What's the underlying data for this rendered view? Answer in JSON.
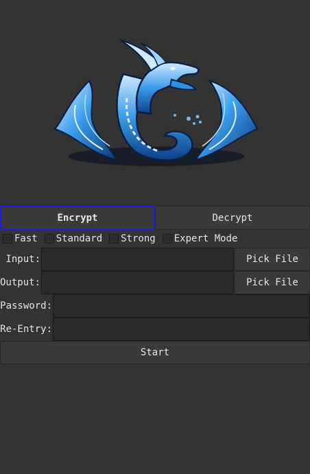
{
  "tabs": {
    "encrypt_label": "Encrypt",
    "decrypt_label": "Decrypt"
  },
  "modes": [
    {
      "label": "Fast",
      "checked": false
    },
    {
      "label": "Standard",
      "checked": false
    },
    {
      "label": "Strong",
      "checked": false
    },
    {
      "label": "Expert Mode",
      "checked": false
    }
  ],
  "fields": {
    "input": {
      "label": "Input:",
      "value": "",
      "pick_label": "Pick File"
    },
    "output": {
      "label": "Output:",
      "value": "",
      "pick_label": "Pick File"
    },
    "password": {
      "label": "Password:",
      "value": ""
    },
    "reentry": {
      "label": "Re-Entry:",
      "value": ""
    }
  },
  "start_label": "Start",
  "colors": {
    "background": "#333333",
    "focus_border": "#1e1ee6",
    "dragon_blue": "#2f8fe0"
  },
  "logo": {
    "icon": "dragon-icon"
  }
}
